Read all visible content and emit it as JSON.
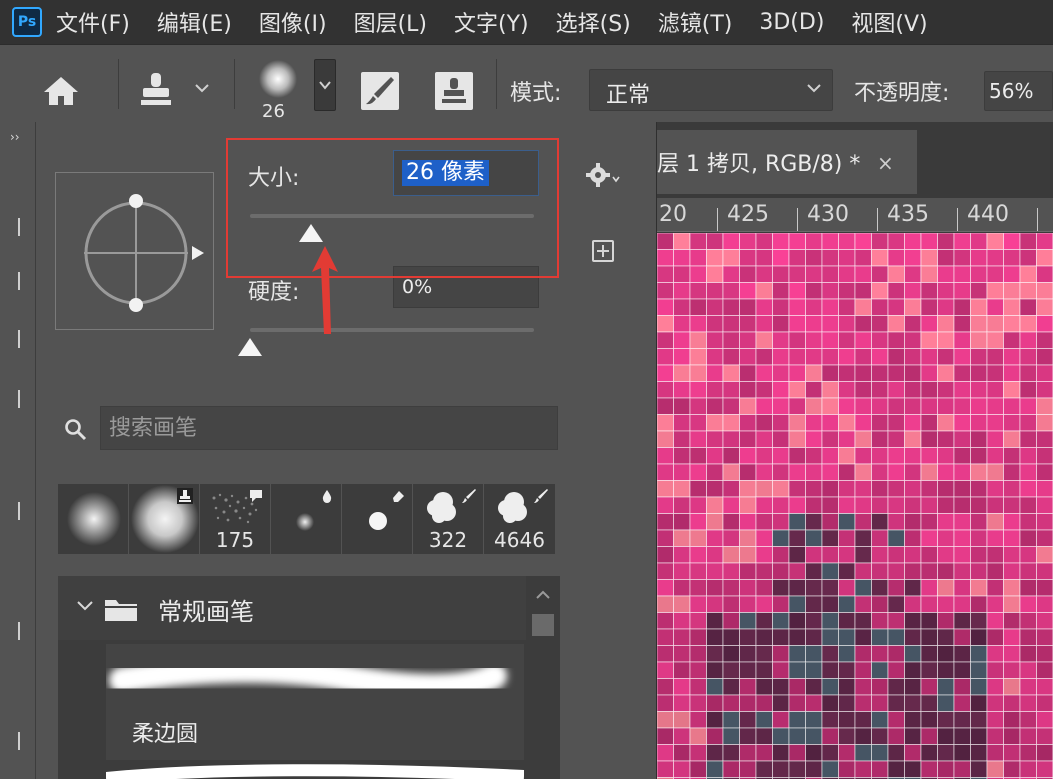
{
  "app": {
    "logo_text": "Ps"
  },
  "menu": [
    "文件(F)",
    "编辑(E)",
    "图像(I)",
    "图层(L)",
    "文字(Y)",
    "选择(S)",
    "滤镜(T)",
    "3D(D)",
    "视图(V)"
  ],
  "options_bar": {
    "brush_size_display": "26",
    "mode_label": "模式:",
    "mode_value": "正常",
    "opacity_label": "不透明度:",
    "opacity_value": "56%"
  },
  "tool_strip": {
    "collapse_glyph": "››"
  },
  "brush_panel": {
    "size_label": "大小:",
    "size_value": "26 像素",
    "size_slider": 0.13,
    "hardness_label": "硬度:",
    "hardness_value": "0%",
    "hardness_slider": 0.0,
    "search_placeholder": "搜索画笔",
    "recent_brushes": [
      {
        "icon": "soft-round-brush-icon",
        "num": ""
      },
      {
        "icon": "soft-round-brush-icon",
        "num": "",
        "badge": "stamp-badge-icon"
      },
      {
        "icon": "spatter-brush-icon",
        "num": "175",
        "badge": "comment-badge-icon"
      },
      {
        "icon": "small-soft-dot-icon",
        "num": "",
        "badge": "water-drop-badge-icon"
      },
      {
        "icon": "hard-dot-icon",
        "num": "",
        "badge": "eraser-badge-icon"
      },
      {
        "icon": "texture-brush-icon",
        "num": "322",
        "badge": "brush-badge-icon"
      },
      {
        "icon": "texture-brush-icon",
        "num": "4646",
        "badge": "brush-badge-icon"
      }
    ],
    "group_title": "常规画笔",
    "brush_item_label": "柔边圆"
  },
  "document": {
    "tab_label": "层 1 拷贝, RGB/8) *",
    "tab_close": "×",
    "ruler": [
      "20",
      "425",
      "430",
      "435",
      "440"
    ]
  },
  "colors": {
    "highlight": "#e23b34",
    "selection": "#1e60c8",
    "canvas_pink": "#e8408a"
  }
}
